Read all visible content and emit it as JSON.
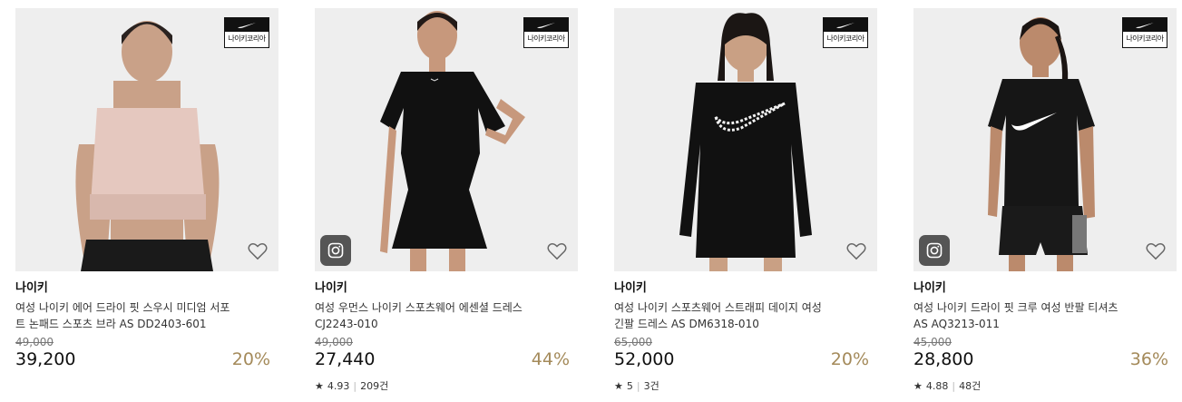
{
  "products": [
    {
      "brand": "나이키",
      "name_line1": "여성 나이키 에어 드라이 핏 스우시 미디엄 서포",
      "name_line2": "트 논패드 스포츠 브라 AS DD2403-601",
      "original_price": "49,000",
      "price": "39,200",
      "discount": "20%",
      "badge_text": "나이키코리아",
      "has_instagram": false,
      "rating": null,
      "review_count": null
    },
    {
      "brand": "나이키",
      "name_line1": "여성 우먼스 나이키 스포츠웨어 에센셜 드레스",
      "name_line2": "CJ2243-010",
      "original_price": "49,000",
      "price": "27,440",
      "discount": "44%",
      "badge_text": "나이키코리아",
      "has_instagram": true,
      "rating": "4.93",
      "review_count": "209건"
    },
    {
      "brand": "나이키",
      "name_line1": "여성 나이키 스포츠웨어 스트래피 데이지 여성",
      "name_line2": "긴팔 드레스 AS DM6318-010",
      "original_price": "65,000",
      "price": "52,000",
      "discount": "20%",
      "badge_text": "나이키코리아",
      "has_instagram": false,
      "rating": "5",
      "review_count": "3건"
    },
    {
      "brand": "나이키",
      "name_line1": "여성 나이키 드라이 핏 크루 여성 반팔 티셔츠",
      "name_line2": "AS AQ3213-011",
      "original_price": "45,000",
      "price": "28,800",
      "discount": "36%",
      "badge_text": "나이키코리아",
      "has_instagram": true,
      "rating": "4.88",
      "review_count": "48건"
    }
  ],
  "colors": {
    "discount": "#a48a5a",
    "image_bg": "#eeeeee"
  },
  "icons": [
    "heart-icon",
    "instagram-icon",
    "star-icon",
    "nike-swoosh-icon"
  ]
}
